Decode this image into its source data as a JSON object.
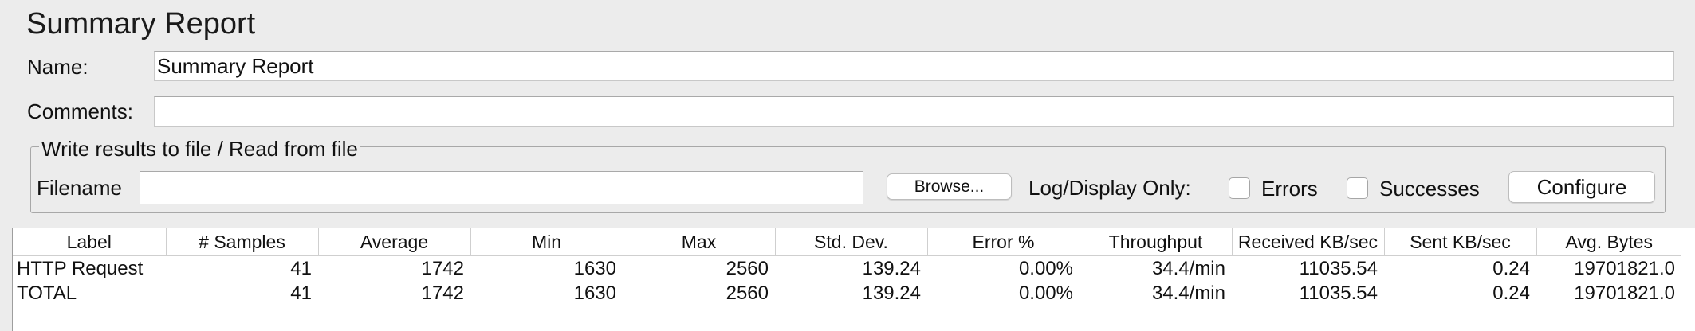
{
  "panel": {
    "title": "Summary Report"
  },
  "name_field": {
    "label": "Name:",
    "value": "Summary Report"
  },
  "comments_field": {
    "label": "Comments:",
    "value": ""
  },
  "file_section": {
    "legend": "Write results to file / Read from file",
    "filename_label": "Filename",
    "filename_value": "",
    "browse_label": "Browse...",
    "log_display_label": "Log/Display Only:",
    "errors_label": "Errors",
    "errors_checked": false,
    "successes_label": "Successes",
    "successes_checked": false,
    "configure_label": "Configure"
  },
  "table": {
    "columns": [
      "Label",
      "# Samples",
      "Average",
      "Min",
      "Max",
      "Std. Dev.",
      "Error %",
      "Throughput",
      "Received KB/sec",
      "Sent KB/sec",
      "Avg. Bytes"
    ],
    "rows": [
      [
        "HTTP Request",
        "41",
        "1742",
        "1630",
        "2560",
        "139.24",
        "0.00%",
        "34.4/min",
        "11035.54",
        "0.24",
        "19701821.0"
      ],
      [
        "TOTAL",
        "41",
        "1742",
        "1630",
        "2560",
        "139.24",
        "0.00%",
        "34.4/min",
        "11035.54",
        "0.24",
        "19701821.0"
      ]
    ]
  }
}
